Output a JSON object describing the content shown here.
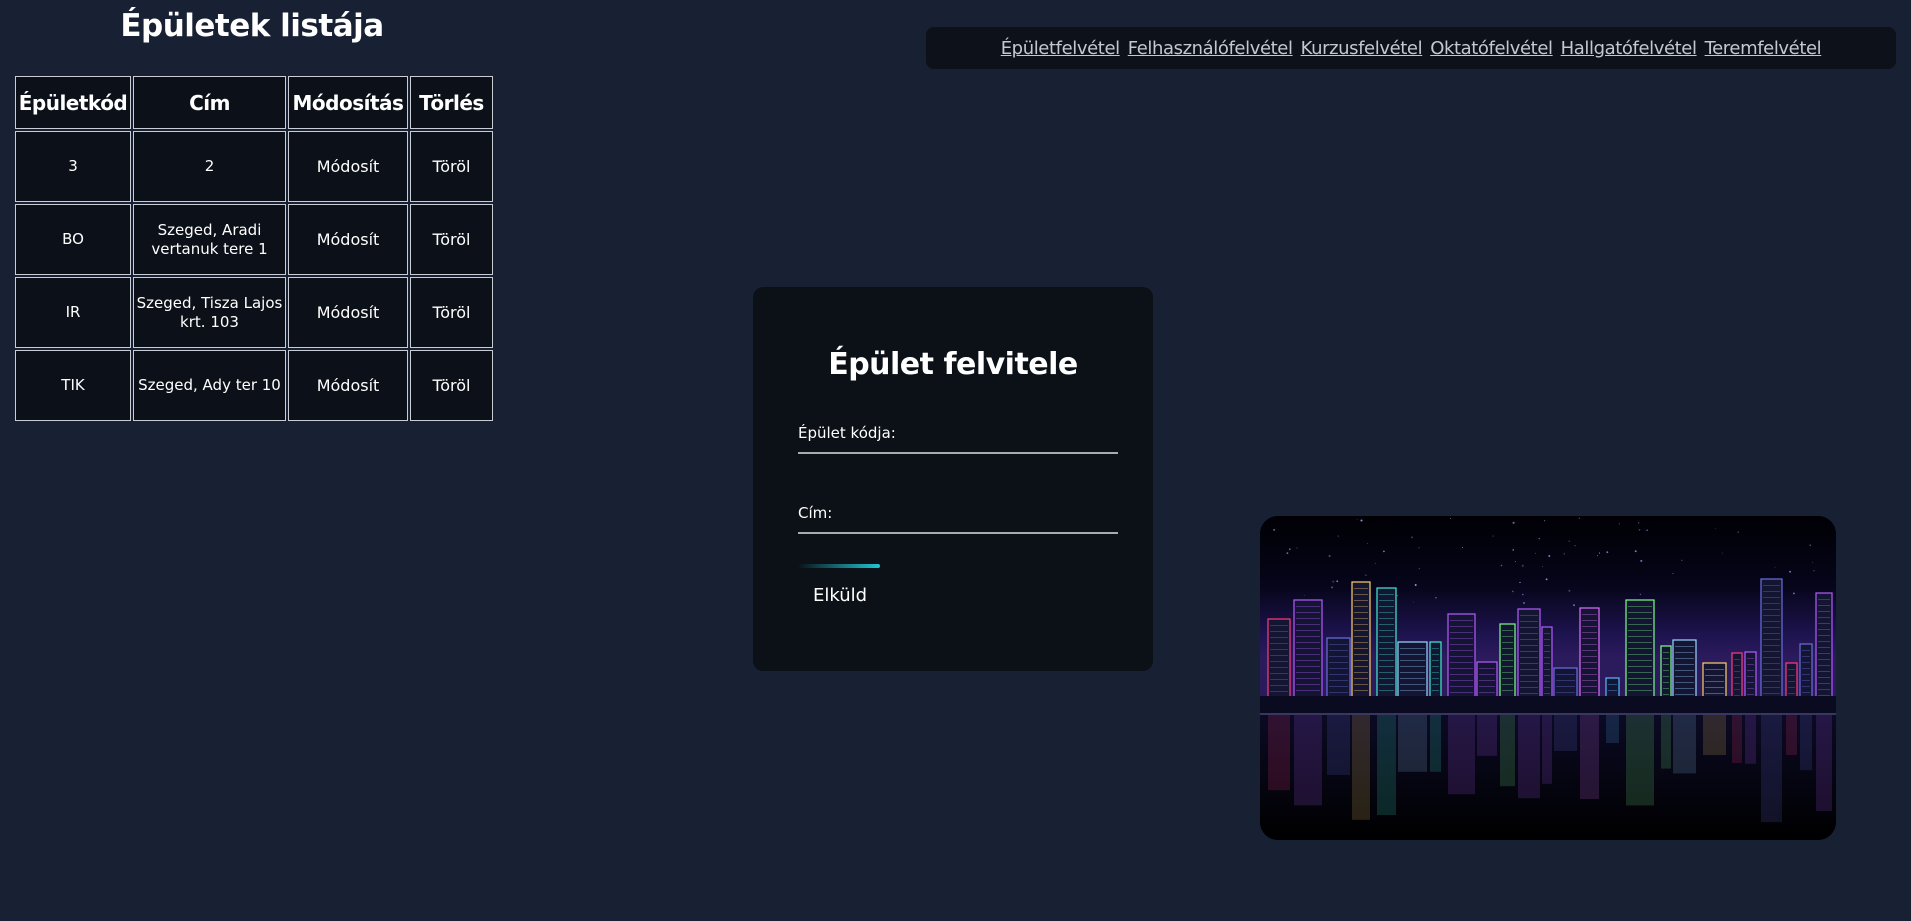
{
  "list": {
    "title": "Épületek listája",
    "headers": [
      "Épületkód",
      "Cím",
      "Módosítás",
      "Törlés"
    ],
    "rows": [
      {
        "code": "3",
        "address": "2",
        "edit": "Módosít",
        "delete": "Töröl"
      },
      {
        "code": "BO",
        "address": "Szeged, Aradi vertanuk tere 1",
        "edit": "Módosít",
        "delete": "Töröl"
      },
      {
        "code": "IR",
        "address": "Szeged, Tisza Lajos krt. 103",
        "edit": "Módosít",
        "delete": "Töröl"
      },
      {
        "code": "TIK",
        "address": "Szeged, Ady ter 10",
        "edit": "Módosít",
        "delete": "Töröl"
      }
    ]
  },
  "nav": {
    "links": [
      "Épületfelvétel",
      "Felhasználófelvétel",
      "Kurzusfelvétel",
      "Oktatófelvétel",
      "Hallgatófelvétel",
      "Teremfelvétel"
    ]
  },
  "form": {
    "title": "Épület felvitele",
    "code_label": "Épület kódja:",
    "code_value": "",
    "address_label": "Cím:",
    "address_value": "",
    "submit_label": "Elküld"
  },
  "image": {
    "subject": "neon-city-skyline"
  },
  "colors": {
    "background": "#182133",
    "panel": "#0c1118",
    "accent": "#1fc6d4",
    "link": "#c4c8d0"
  }
}
